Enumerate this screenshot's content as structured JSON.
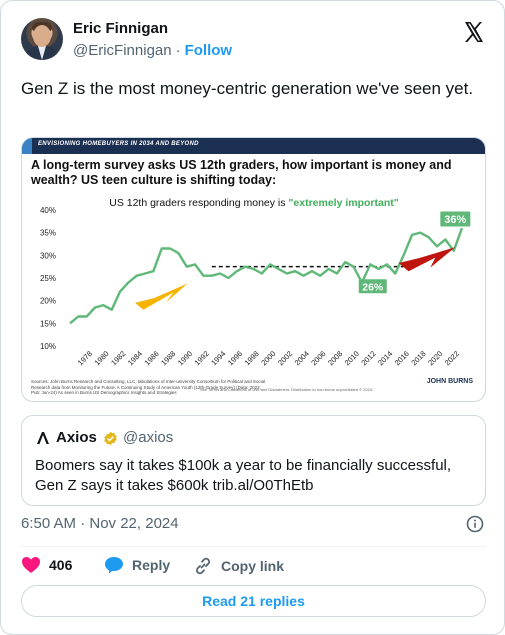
{
  "author": {
    "name": "Eric Finnigan",
    "handle": "@EricFinnigan",
    "separator": "·",
    "follow_label": "Follow"
  },
  "tweet": {
    "text": "Gen Z is the most money-centric generation we've seen yet."
  },
  "chart_card": {
    "band_text": "ENVISIONING HOMEBUYERS IN 2034 AND BEYOND",
    "headline": "A long-term survey asks US 12th graders, how important is money and wealth? US teen culture is shifting today:",
    "source_text": "Sources: John Burns Research and Consulting, LLC, tabulations of Inter-university Consortium for Political and Social Research data from Monitoring the Future: A Continuing Study of American Youth (12th-Grade Survey) (Data: 2022, Pub: Jun-24)  As seen in Burns US Demographics Insights and Strategies",
    "terms_text": "See Terms and Conditions of Use and Disclaimers. Distribution to non-burns unprohibited © 2024.",
    "brand": "JOHN BURNS"
  },
  "chart_data": {
    "type": "line",
    "title": "US 12th graders responding money is",
    "title_highlight": "\"extremely important\"",
    "ylim": [
      10,
      40
    ],
    "yticks": [
      "40%",
      "35%",
      "30%",
      "25%",
      "20%",
      "15%",
      "10%"
    ],
    "xticks": [
      "1978",
      "1980",
      "1982",
      "1984",
      "1986",
      "1988",
      "1990",
      "1992",
      "1994",
      "1996",
      "1998",
      "2000",
      "2002",
      "2004",
      "2006",
      "2008",
      "2010",
      "2012",
      "2014",
      "2016",
      "2018",
      "2020",
      "2022"
    ],
    "x": [
      1976,
      1977,
      1978,
      1979,
      1980,
      1981,
      1982,
      1983,
      1984,
      1985,
      1986,
      1987,
      1988,
      1989,
      1990,
      1991,
      1992,
      1993,
      1994,
      1995,
      1996,
      1997,
      1998,
      1999,
      2000,
      2001,
      2002,
      2003,
      2004,
      2005,
      2006,
      2007,
      2008,
      2009,
      2010,
      2011,
      2012,
      2013,
      2014,
      2015,
      2016,
      2017,
      2018,
      2019,
      2020,
      2021,
      2022,
      2023
    ],
    "series": [
      {
        "values": [
          15,
          16.5,
          16.5,
          18.5,
          19,
          18,
          22,
          24,
          25.5,
          26,
          26.5,
          31.5,
          31.5,
          30.5,
          27.5,
          28,
          25.5,
          25.5,
          26,
          25,
          26.5,
          27.5,
          27,
          26,
          28,
          27,
          26,
          26.5,
          25.5,
          26.5,
          25.5,
          27,
          26,
          28.5,
          27.5,
          24,
          28,
          27,
          28,
          26,
          30,
          34.5,
          35,
          34,
          32,
          33.5,
          31,
          36
        ],
        "color": "#5fb878"
      }
    ],
    "reference_line": {
      "value": 27.5,
      "from": 1993,
      "to": 2016
    },
    "annotations": [
      "26%",
      "36%"
    ],
    "grid": false
  },
  "quote": {
    "name": "Axios",
    "handle": "@axios",
    "text": "Boomers say it takes $100k a year to be financially successful, Gen Z says it takes $600k trib.al/O0ThEtb"
  },
  "meta": {
    "timestamp": "6:50 AM · Nov 22, 2024"
  },
  "actions": {
    "like_count": "406",
    "reply_label": "Reply",
    "copy_label": "Copy link",
    "read_replies": "Read 21 replies"
  },
  "colors": {
    "accent": "#1d9bf0",
    "like": "#f91880",
    "series": "#5fb878"
  }
}
